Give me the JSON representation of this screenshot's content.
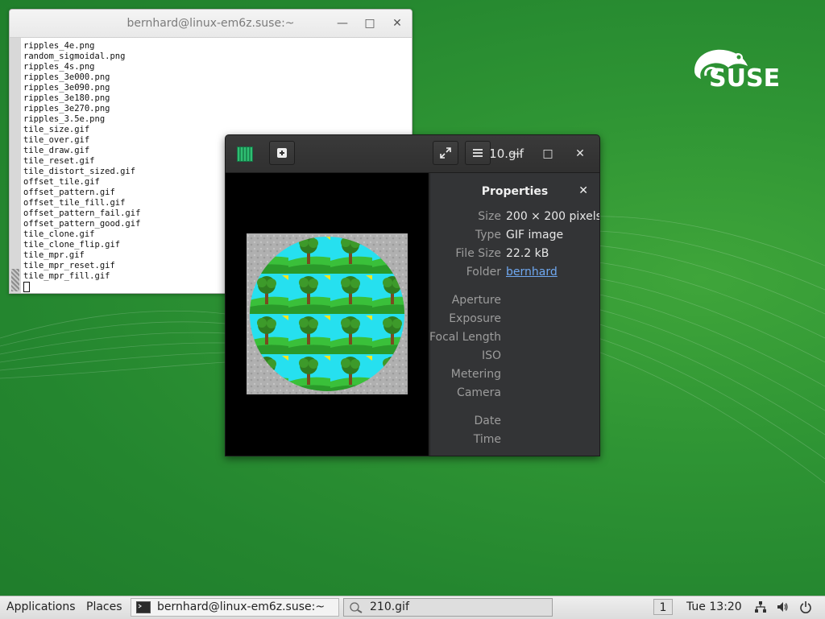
{
  "desktop": {
    "brand": "SUSE"
  },
  "terminal": {
    "title": "bernhard@linux-em6z.suse:~",
    "lines": [
      "ripples_4e.png",
      "random_sigmoidal.png",
      "ripples_4s.png",
      "ripples_3e000.png",
      "ripples_3e090.png",
      "ripples_3e180.png",
      "ripples_3e270.png",
      "ripples_3.5e.png",
      "tile_size.gif",
      "tile_over.gif",
      "tile_draw.gif",
      "tile_reset.gif",
      "tile_distort_sized.gif",
      "offset_tile.gif",
      "offset_pattern.gif",
      "offset_tile_fill.gif",
      "offset_pattern_fail.gif",
      "offset_pattern_good.gif",
      "tile_clone.gif",
      "tile_clone_flip.gif",
      "tile_mpr.gif",
      "tile_mpr_reset.gif",
      "tile_mpr_fill.gif"
    ]
  },
  "viewer": {
    "title": "210.gif",
    "properties": {
      "heading": "Properties",
      "rows": [
        {
          "key": "Size",
          "value": "200 × 200 pixels"
        },
        {
          "key": "Type",
          "value": "GIF image"
        },
        {
          "key": "File Size",
          "value": "22.2 kB"
        },
        {
          "key": "Folder",
          "value": "bernhard"
        },
        {
          "key": "Aperture",
          "value": ""
        },
        {
          "key": "Exposure",
          "value": ""
        },
        {
          "key": "Focal Length",
          "value": ""
        },
        {
          "key": "ISO",
          "value": ""
        },
        {
          "key": "Metering",
          "value": ""
        },
        {
          "key": "Camera",
          "value": ""
        },
        {
          "key": "Date",
          "value": ""
        },
        {
          "key": "Time",
          "value": ""
        }
      ]
    }
  },
  "taskbar": {
    "applications": "Applications",
    "places": "Places",
    "windows": [
      {
        "label": "bernhard@linux-em6z.suse:~",
        "icon": "terminal-icon"
      },
      {
        "label": "210.gif",
        "icon": "image-viewer-icon"
      }
    ],
    "workspace": "1",
    "clock": "Tue 13:20"
  }
}
